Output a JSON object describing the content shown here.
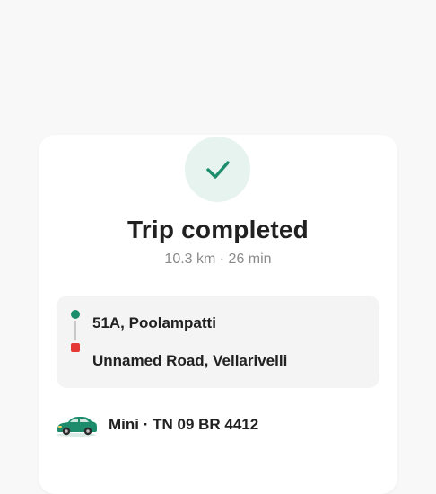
{
  "trip": {
    "title": "Trip completed",
    "meta": "10.3 km · 26 min"
  },
  "route": {
    "pickup": "51A, Poolampatti",
    "drop": "Unnamed Road, Vellarivelli"
  },
  "vehicle": {
    "label": "Mini · TN 09 BR 4412",
    "icon": "car-icon"
  },
  "colors": {
    "accent": "#1c8c6c",
    "check_bg": "#e6f3ef",
    "drop_marker": "#e53935"
  }
}
